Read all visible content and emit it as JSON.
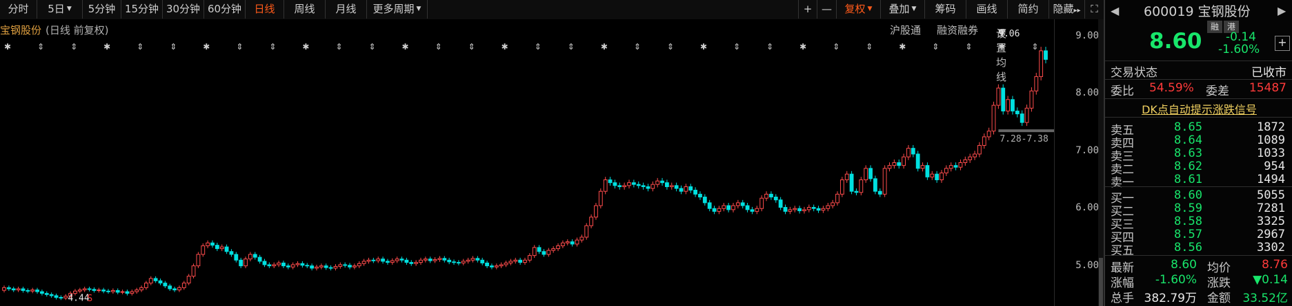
{
  "toolbar": {
    "periods": [
      "分时",
      "5日",
      "5分钟",
      "15分钟",
      "30分钟",
      "60分钟",
      "日线",
      "周线",
      "月线",
      "更多周期"
    ],
    "active_period": "日线",
    "right_buttons": [
      "复权",
      "叠加",
      "筹码",
      "画线",
      "简约",
      "隐藏"
    ],
    "plus": "+",
    "minus": "—",
    "hide_arrow": "▸▸",
    "fullscreen": "⛶"
  },
  "chart": {
    "stock_label": "宝钢股份",
    "mode_label": "(日线 前复权)",
    "links": [
      "沪股通",
      "融资融券",
      "设置均线"
    ],
    "high_label": "9.06",
    "low_label": "4.44",
    "range_label": "7.28-7.38",
    "s_marker": "S",
    "price_ticks": [
      "9.00",
      "8.00",
      "7.00",
      "6.00",
      "5.00"
    ]
  },
  "chart_data": {
    "type": "candlestick",
    "y_range": [
      4.3,
      9.3
    ],
    "y_ticks": [
      9.0,
      8.0,
      7.0,
      6.0,
      5.0
    ],
    "period": "日线",
    "adjust": "前复权",
    "marked_high": 9.06,
    "marked_low": 4.44,
    "closes": [
      4.62,
      4.6,
      4.58,
      4.6,
      4.57,
      4.56,
      4.58,
      4.55,
      4.52,
      4.5,
      4.48,
      4.45,
      4.44,
      4.47,
      4.52,
      4.56,
      4.58,
      4.6,
      4.59,
      4.57,
      4.58,
      4.56,
      4.55,
      4.57,
      4.54,
      4.55,
      4.52,
      4.55,
      4.58,
      4.62,
      4.7,
      4.78,
      4.74,
      4.7,
      4.65,
      4.6,
      4.58,
      4.62,
      4.7,
      4.82,
      5.0,
      5.2,
      5.35,
      5.4,
      5.36,
      5.3,
      5.33,
      5.25,
      5.2,
      5.1,
      5.0,
      5.12,
      5.2,
      5.15,
      5.08,
      5.02,
      5.0,
      5.02,
      5.05,
      5.0,
      4.98,
      5.02,
      5.04,
      5.01,
      5.0,
      4.96,
      4.98,
      5.0,
      4.97,
      4.96,
      4.99,
      5.02,
      5.01,
      4.98,
      5.0,
      5.04,
      5.08,
      5.1,
      5.09,
      5.12,
      5.08,
      5.06,
      5.09,
      5.12,
      5.1,
      5.06,
      5.04,
      5.06,
      5.1,
      5.12,
      5.09,
      5.11,
      5.13,
      5.1,
      5.07,
      5.06,
      5.05,
      5.08,
      5.1,
      5.13,
      5.1,
      5.05,
      5.0,
      4.98,
      5.0,
      5.02,
      5.05,
      5.08,
      5.1,
      5.06,
      5.1,
      5.18,
      5.32,
      5.25,
      5.2,
      5.27,
      5.3,
      5.35,
      5.4,
      5.42,
      5.38,
      5.45,
      5.5,
      5.7,
      5.85,
      6.05,
      6.3,
      6.5,
      6.45,
      6.4,
      6.38,
      6.4,
      6.45,
      6.42,
      6.4,
      6.38,
      6.35,
      6.42,
      6.48,
      6.45,
      6.38,
      6.4,
      6.35,
      6.3,
      6.38,
      6.32,
      6.25,
      6.2,
      6.1,
      6.0,
      5.95,
      6.0,
      6.05,
      5.98,
      6.05,
      6.1,
      6.05,
      5.98,
      5.95,
      6.0,
      6.18,
      6.25,
      6.2,
      6.15,
      6.02,
      5.95,
      5.98,
      6.0,
      5.96,
      5.98,
      6.02,
      6.0,
      5.97,
      6.0,
      6.05,
      6.1,
      6.25,
      6.5,
      6.6,
      6.3,
      6.28,
      6.5,
      6.7,
      6.52,
      6.3,
      6.25,
      6.7,
      6.75,
      6.8,
      6.75,
      6.9,
      7.05,
      6.95,
      6.7,
      6.75,
      6.55,
      6.6,
      6.5,
      6.62,
      6.7,
      6.75,
      6.72,
      6.8,
      6.85,
      6.9,
      6.95,
      7.1,
      7.25,
      7.35,
      7.8,
      8.1,
      7.7,
      7.9,
      7.7,
      7.65,
      7.5,
      7.75,
      8.05,
      8.3,
      8.75,
      8.6
    ]
  },
  "panel": {
    "prev_arrow": "◀",
    "next_arrow": "▶",
    "code": "600019",
    "name": "宝钢股份",
    "badges": [
      "融",
      "港"
    ],
    "price": "8.60",
    "change": "-0.14",
    "change_pct": "-1.60%",
    "plus": "+",
    "status_label": "交易状态",
    "status_value": "已收市",
    "weibi_label": "委比",
    "weibi_value": "54.59%",
    "weicha_label": "委差",
    "weicha_value": "15487",
    "dk_link": "DK点自动提示涨跌信号",
    "orderbook": [
      {
        "label": "卖五",
        "price": "8.65",
        "vol": "1872"
      },
      {
        "label": "卖四",
        "price": "8.64",
        "vol": "1089"
      },
      {
        "label": "卖三",
        "price": "8.63",
        "vol": "1033"
      },
      {
        "label": "卖二",
        "price": "8.62",
        "vol": "954"
      },
      {
        "label": "卖一",
        "price": "8.61",
        "vol": "1494"
      },
      {
        "label": "买一",
        "price": "8.60",
        "vol": "5055"
      },
      {
        "label": "买二",
        "price": "8.59",
        "vol": "7281"
      },
      {
        "label": "买三",
        "price": "8.58",
        "vol": "3325"
      },
      {
        "label": "买四",
        "price": "8.57",
        "vol": "2967"
      },
      {
        "label": "买五",
        "price": "8.56",
        "vol": "3302"
      }
    ],
    "stats": [
      {
        "l1": "最新",
        "v1": "8.60",
        "l2": "均价",
        "v2": "8.76"
      },
      {
        "l1": "涨幅",
        "v1": "-1.60%",
        "l2": "涨跌",
        "v2": "▼0.14"
      },
      {
        "l1": "总手",
        "v1": "382.79万",
        "l2": "金额",
        "v2": "33.52亿"
      }
    ]
  },
  "colors": {
    "up": "#ff4c4c",
    "down": "#00e0e0",
    "green": "#18e66b",
    "accent": "#ff5a1a",
    "warn": "#ff3a3a"
  }
}
